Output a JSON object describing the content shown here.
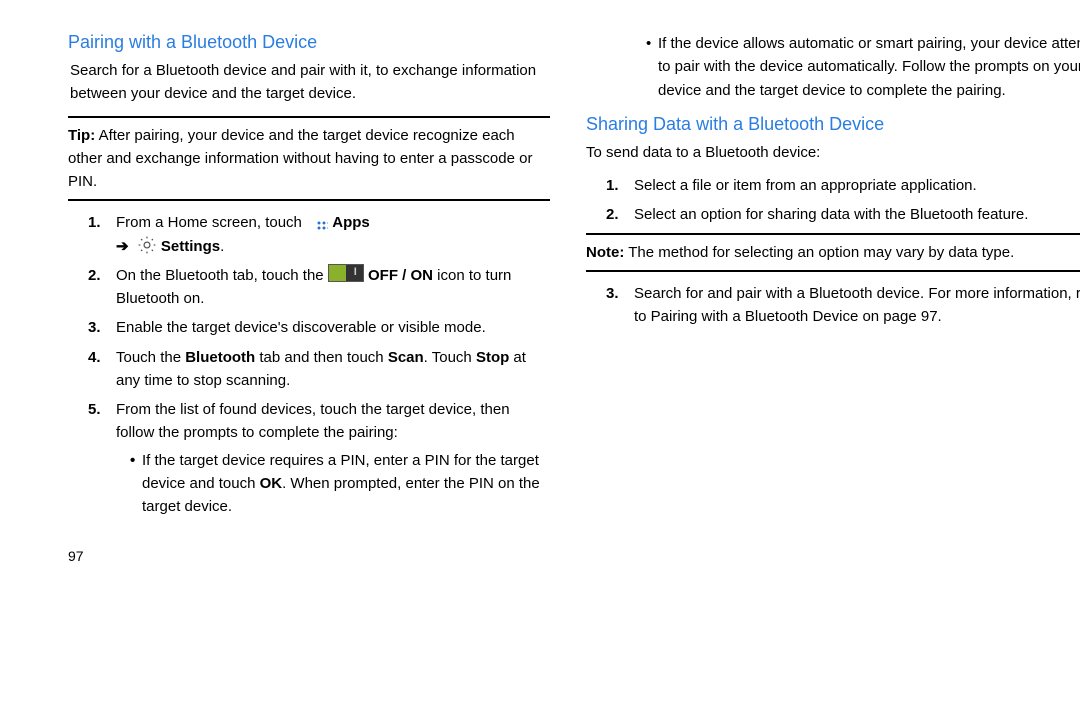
{
  "page_number": "97",
  "left": {
    "heading": "Pairing with a Bluetooth Device",
    "intro": "Search for a Bluetooth device and pair with it, to exchange information between your device and the target device.",
    "tip_label": "Tip:",
    "tip": "After pairing, your device and the target device recognize each other and exchange information without having to enter a passcode or PIN.",
    "step1_a": "From a Home screen, touch ",
    "step1_apps": "Apps",
    "step1_arrow": "➔",
    "step1_settings": "Settings",
    "step2_a": "On the Bluetooth tab, touch the ",
    "step2_toggle_label": "OFF / ON",
    "step2_b": " icon to turn Bluetooth on.",
    "step3": "Enable the target device's discoverable or visible mode.",
    "step4_a": "Touch the ",
    "step4_bt": "Bluetooth",
    "step4_b": " tab and then touch ",
    "step4_scan": "Scan",
    "step4_c": ". Touch ",
    "step4_stop": "Stop",
    "step4_d": " at any time to stop scanning.",
    "step5": "From the list of found devices, touch the target device, then follow the prompts to complete the pairing:",
    "step5_sub1_a": "If the target device requires a PIN, enter a PIN for the target device and touch ",
    "step5_sub1_ok": "OK",
    "step5_sub1_b": ". When prompted, enter the PIN on the target device."
  },
  "right": {
    "cont_sub": "If the device allows automatic or smart pairing, your device attempts to pair with the device automatically. Follow the prompts on your device and the target device to complete the pairing.",
    "heading": "Sharing Data with a Bluetooth Device",
    "intro": "To send data to a Bluetooth device:",
    "step1": "Select a file or item from an appropriate application.",
    "step2": "Select an option for sharing data with the Bluetooth feature.",
    "note_label": "Note:",
    "note": "The method for selecting an option may vary by data type.",
    "step3": "Search for and pair with a Bluetooth device. For more information, refer to  Pairing with a Bluetooth Device  on page 97."
  }
}
